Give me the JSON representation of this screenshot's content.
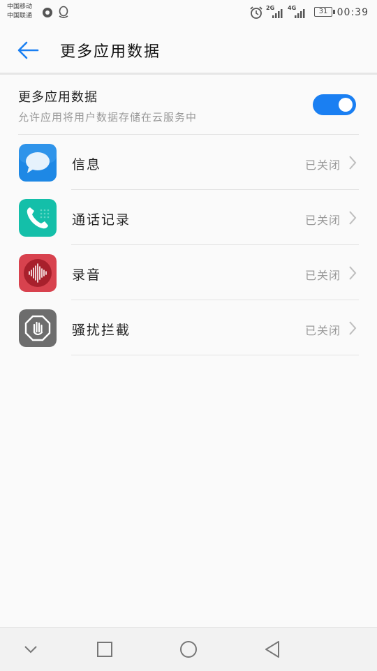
{
  "status_bar": {
    "carrier_1": "中国移动",
    "carrier_2": "中国联通",
    "signal_1_label": "2G",
    "signal_2_label": "4G",
    "battery": "31",
    "time": "00:39"
  },
  "header": {
    "title": "更多应用数据"
  },
  "toggle": {
    "title": "更多应用数据",
    "subtitle": "允许应用将用户数据存储在云服务中",
    "enabled": true,
    "on_color": "#1a7ff2"
  },
  "apps": [
    {
      "name": "信息",
      "status": "已关闭",
      "icon": "message-bubble-icon",
      "color": "#1e88e5"
    },
    {
      "name": "通话记录",
      "status": "已关闭",
      "icon": "phone-handset-icon",
      "color": "#14bfa9"
    },
    {
      "name": "录音",
      "status": "已关闭",
      "icon": "audio-wave-icon",
      "color": "#c62f3b"
    },
    {
      "name": "骚扰拦截",
      "status": "已关闭",
      "icon": "stop-hand-icon",
      "color": "#6d6d6d"
    }
  ],
  "nav": {
    "icons": [
      "chevron-down-icon",
      "square-recent-icon",
      "circle-home-icon",
      "triangle-back-icon"
    ]
  }
}
